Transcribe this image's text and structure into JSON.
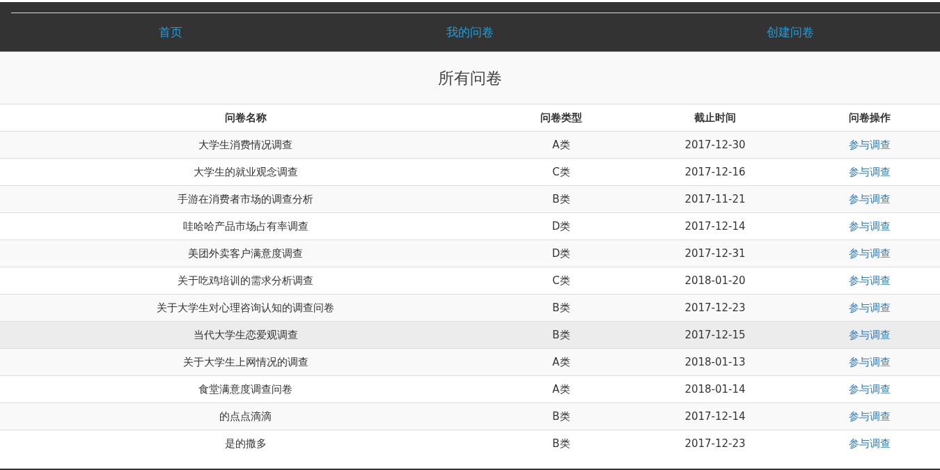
{
  "nav": {
    "links": [
      {
        "label": "首页"
      },
      {
        "label": "我的问卷"
      },
      {
        "label": "创建问卷"
      }
    ]
  },
  "heading": "所有问卷",
  "table": {
    "columns": [
      "问卷名称",
      "问卷类型",
      "截止时间",
      "问卷操作"
    ],
    "rows": [
      {
        "name": "大学生消费情况调查",
        "type": "A类",
        "deadline": "2017-12-30",
        "action": "参与调查",
        "hovered": false
      },
      {
        "name": "大学生的就业观念调查",
        "type": "C类",
        "deadline": "2017-12-16",
        "action": "参与调查",
        "hovered": false
      },
      {
        "name": "手游在消费者市场的调查分析",
        "type": "B类",
        "deadline": "2017-11-21",
        "action": "参与调查",
        "hovered": false
      },
      {
        "name": "哇哈哈产品市场占有率调查",
        "type": "D类",
        "deadline": "2017-12-14",
        "action": "参与调查",
        "hovered": false
      },
      {
        "name": "美团外卖客户满意度调查",
        "type": "D类",
        "deadline": "2017-12-31",
        "action": "参与调查",
        "hovered": false
      },
      {
        "name": "关于吃鸡培训的需求分析调查",
        "type": "C类",
        "deadline": "2018-01-20",
        "action": "参与调查",
        "hovered": false
      },
      {
        "name": "关于大学生对心理咨询认知的调查问卷",
        "type": "B类",
        "deadline": "2017-12-23",
        "action": "参与调查",
        "hovered": false
      },
      {
        "name": "当代大学生恋爱观调查",
        "type": "B类",
        "deadline": "2017-12-15",
        "action": "参与调查",
        "hovered": true
      },
      {
        "name": "关于大学生上网情况的调查",
        "type": "A类",
        "deadline": "2018-01-13",
        "action": "参与调查",
        "hovered": false
      },
      {
        "name": "食堂满意度调查问卷",
        "type": "A类",
        "deadline": "2018-01-14",
        "action": "参与调查",
        "hovered": false
      },
      {
        "name": "的点点滴滴",
        "type": "B类",
        "deadline": "2017-12-14",
        "action": "参与调查",
        "hovered": false
      },
      {
        "name": "是的撒多",
        "type": "B类",
        "deadline": "2017-12-23",
        "action": "参与调查",
        "hovered": false
      }
    ]
  }
}
